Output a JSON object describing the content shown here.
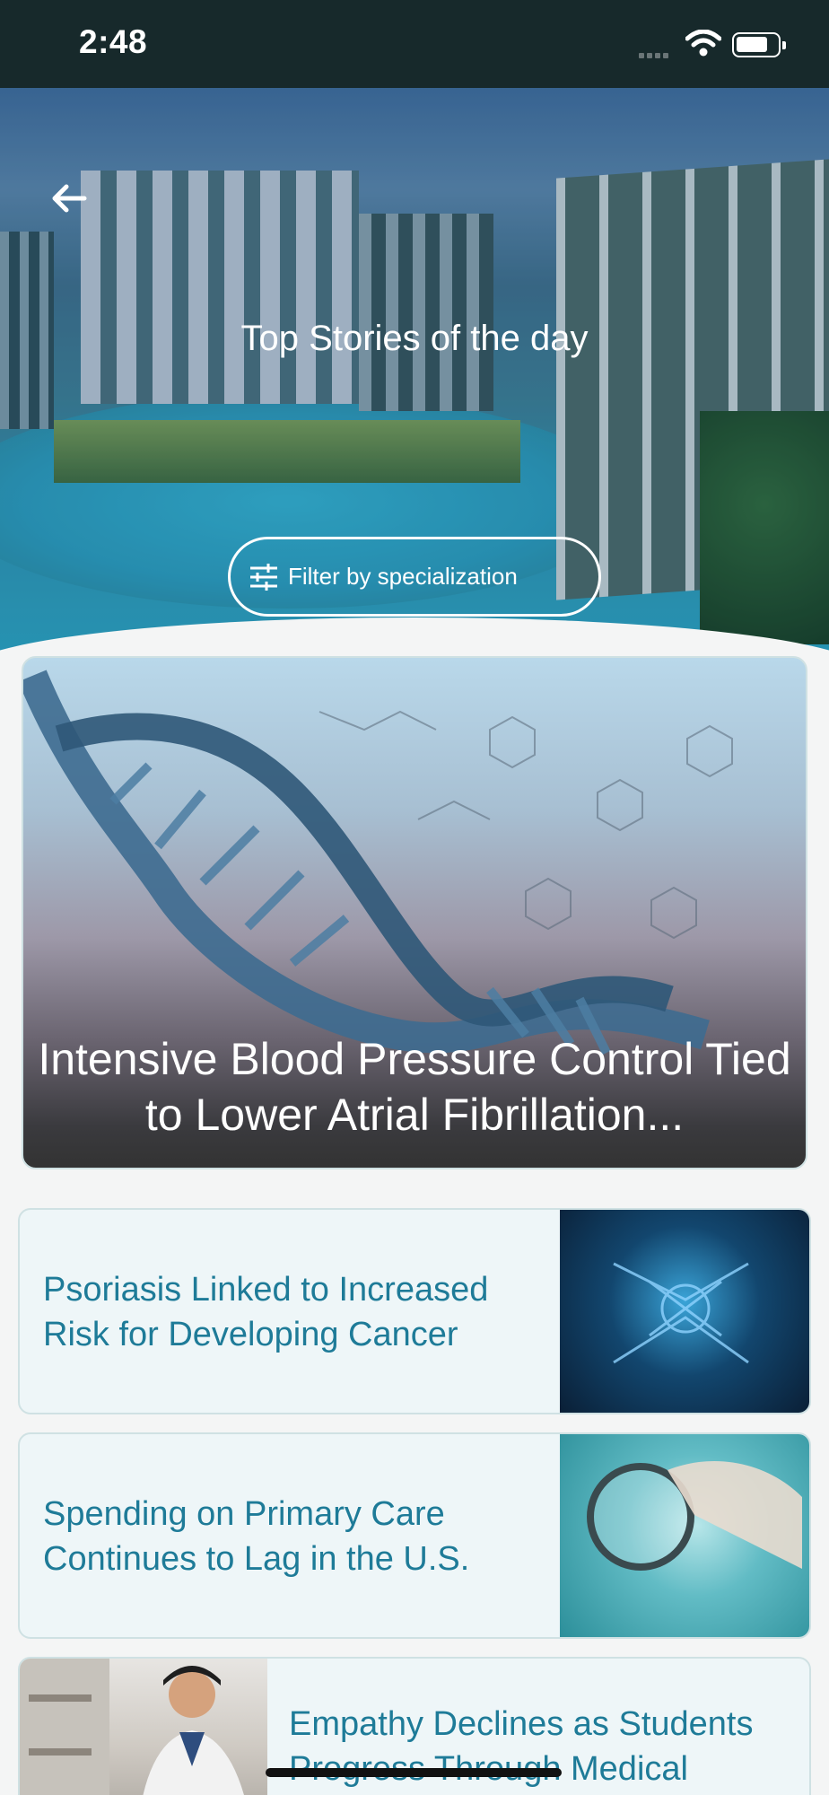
{
  "status_bar": {
    "time": "2:48"
  },
  "hero": {
    "title": "Top Stories of the day",
    "filter_label": "Filter by specialization"
  },
  "featured": {
    "title": "Intensive Blood Pressure Control Tied to Lower Atrial Fibrillation..."
  },
  "stories": [
    {
      "title": "Psoriasis Linked to Increased Risk for Developing Cancer"
    },
    {
      "title": "Spending on Primary Care Continues to Lag in the U.S."
    },
    {
      "title": "Empathy Declines as Students Progress Through Medical School"
    }
  ],
  "colors": {
    "status_bar": "#17292b",
    "story_title": "#1e7b98",
    "card_bg": "#eef6f8"
  }
}
